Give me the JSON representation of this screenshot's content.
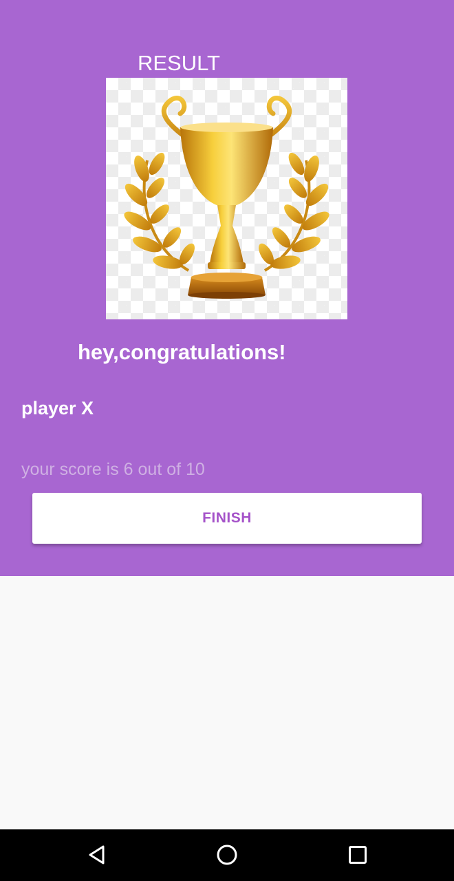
{
  "result": {
    "title": "RESULT",
    "trophy_image": "trophy-with-laurels-icon",
    "congrats_text": "hey,congratulations!",
    "player_text": "player X",
    "score_text": "your score is 6 out of 10",
    "finish_label": "FINISH"
  },
  "colors": {
    "panel_background": "#a866d1",
    "finish_text": "#a553c9",
    "score_text": "#cfb0e3",
    "page_background": "#f9f9f9"
  },
  "navbar": {
    "buttons": [
      "back-icon",
      "home-icon",
      "recents-icon"
    ]
  }
}
